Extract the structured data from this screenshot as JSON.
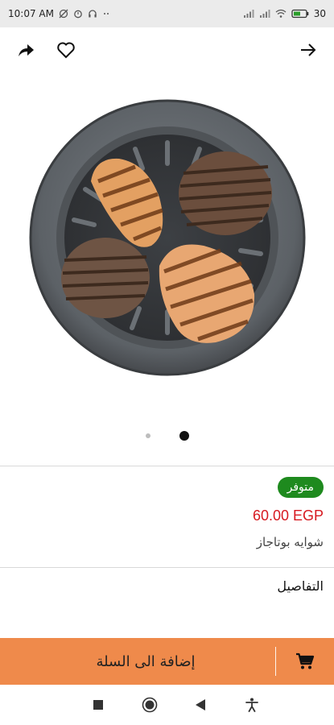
{
  "status_bar": {
    "time": "10:07 AM",
    "battery": "30"
  },
  "toolbar": {
    "share_icon": "share-icon",
    "favorite_icon": "heart-icon",
    "back_icon": "arrow-right-icon"
  },
  "gallery": {
    "image_count": 2,
    "active_index": 1
  },
  "product": {
    "availability": "متوفر",
    "price": "60.00 EGP",
    "name": "شوايه بوتاجاز",
    "details_heading": "التفاصيل"
  },
  "cart": {
    "add_label": "إضافة الى السلة",
    "icon": "cart-icon"
  },
  "colors": {
    "accent": "#ef8a4b",
    "price": "#d71920",
    "badge": "#1e8a1e"
  }
}
